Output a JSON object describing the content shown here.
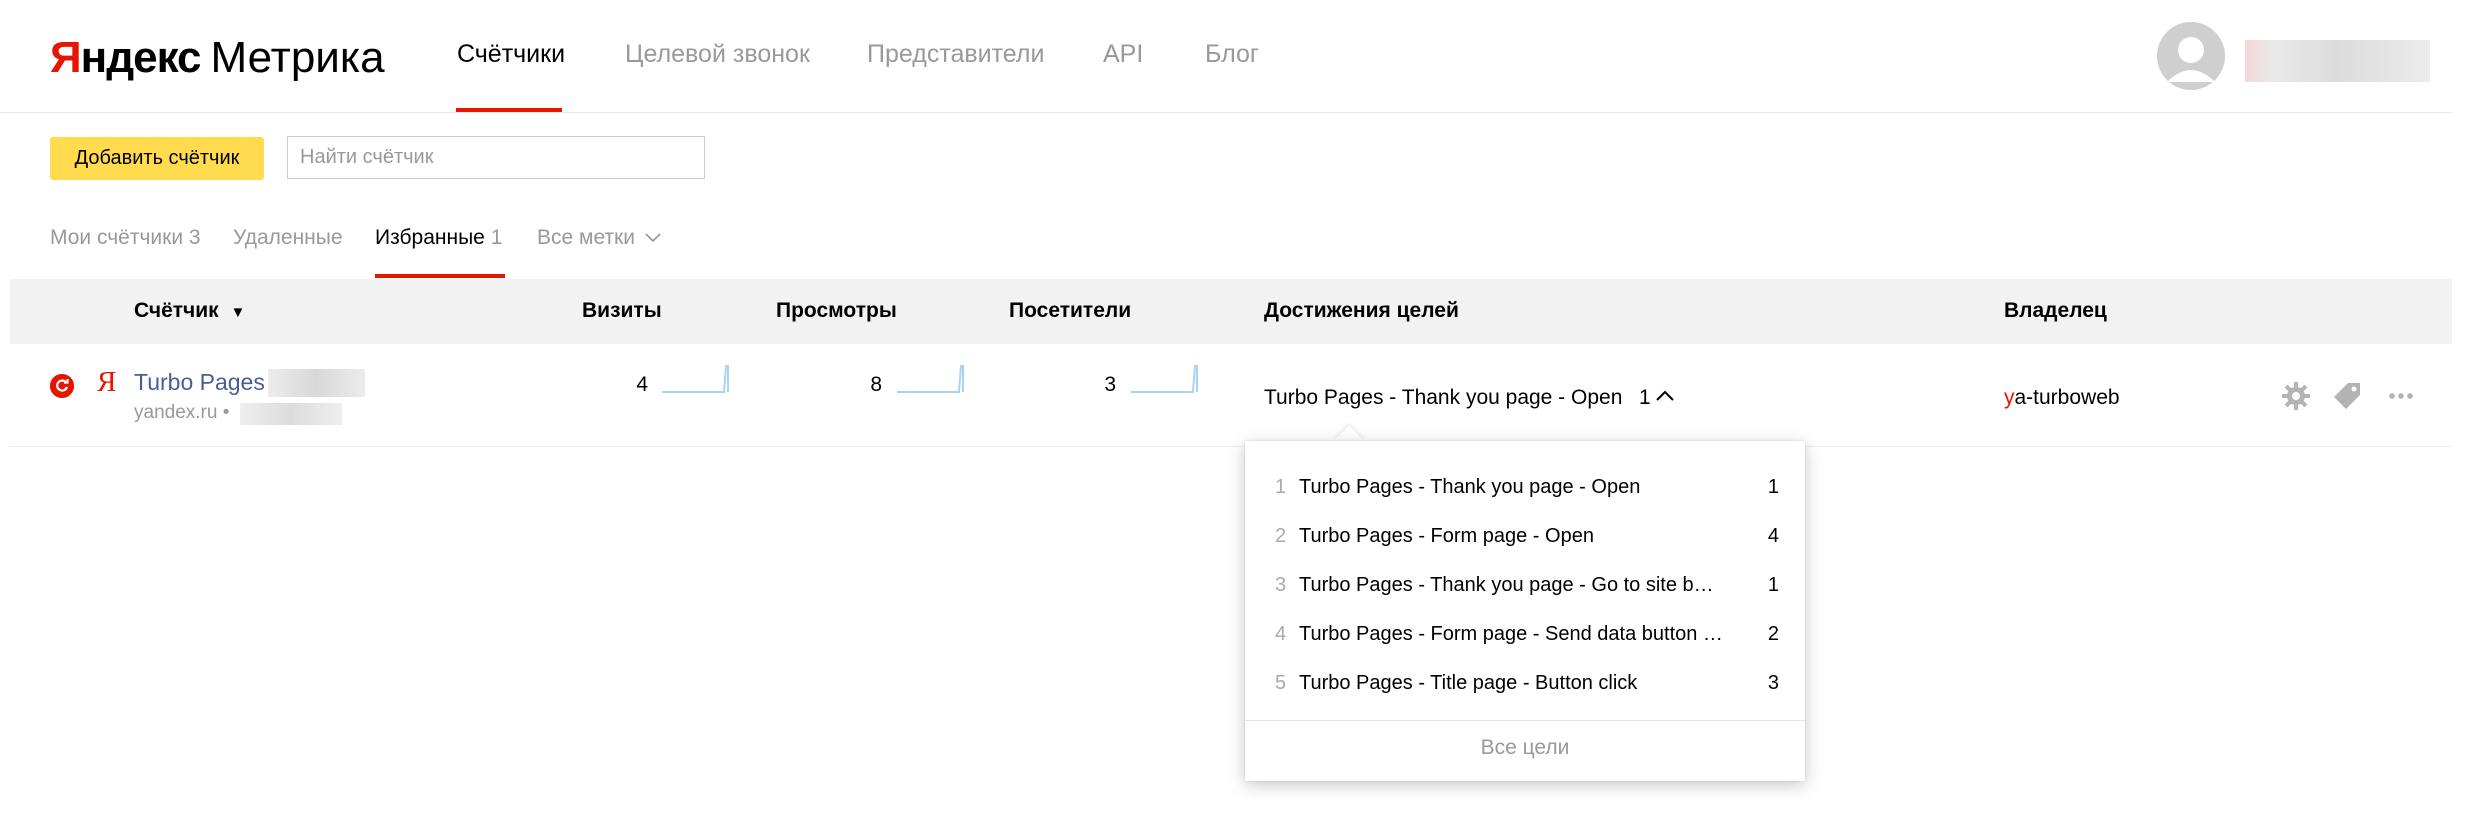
{
  "header": {
    "logo_brand_part1": "Я",
    "logo_brand_part2": "ндекс",
    "logo_product": "Метрика",
    "nav": [
      {
        "label": "Счётчики",
        "active": true
      },
      {
        "label": "Целевой звонок",
        "active": false
      },
      {
        "label": "Представители",
        "active": false
      },
      {
        "label": "API",
        "active": false
      },
      {
        "label": "Блог",
        "active": false
      }
    ]
  },
  "toolbar": {
    "add_button": "Добавить счётчик",
    "search_placeholder": "Найти счётчик",
    "search_value": ""
  },
  "filters": {
    "my_counters_label": "Мои счётчики",
    "my_counters_count": "3",
    "deleted_label": "Удаленные",
    "favorites_label": "Избранные",
    "favorites_count": "1",
    "all_tags_label": "Все метки"
  },
  "table": {
    "columns": {
      "counter": "Счётчик",
      "visits": "Визиты",
      "views": "Просмотры",
      "visitors": "Посетители",
      "goals": "Достижения целей",
      "owner": "Владелец"
    },
    "row": {
      "name": "Turbo Pages",
      "domain": "yandex.ru •",
      "visits": "4",
      "views": "8",
      "visitors": "3",
      "goal_summary": "Turbo Pages - Thank you page - Open",
      "goal_summary_count": "1",
      "owner_first_letter": "y",
      "owner_rest": "a-turboweb"
    }
  },
  "goals_dropdown": {
    "items": [
      {
        "index": "1",
        "name": "Turbo Pages - Thank you page - Open",
        "count": "1"
      },
      {
        "index": "2",
        "name": "Turbo Pages - Form page - Open",
        "count": "4"
      },
      {
        "index": "3",
        "name": "Turbo Pages - Thank you page - Go to site b…",
        "count": "1"
      },
      {
        "index": "4",
        "name": "Turbo Pages - Form page - Send data button …",
        "count": "2"
      },
      {
        "index": "5",
        "name": "Turbo Pages - Title page - Button click",
        "count": "3"
      }
    ],
    "all_goals_link": "Все цели"
  },
  "colors": {
    "accent_red": "#e61400",
    "button_yellow": "#ffdb4d",
    "link_blue": "#4b5d99",
    "sparkline_blue": "#a6d4f2"
  }
}
